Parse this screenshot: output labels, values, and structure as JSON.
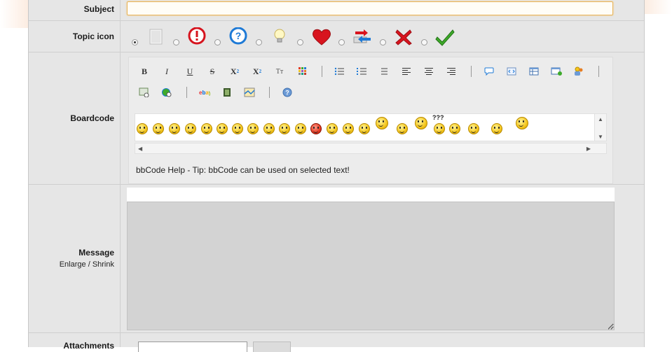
{
  "subject": {
    "label": "Subject",
    "value": ""
  },
  "topic_icon": {
    "label": "Topic icon",
    "selected_index": 0,
    "icons": [
      "blank-page-icon",
      "exclamation-icon",
      "question-icon",
      "lightbulb-icon",
      "heart-icon",
      "redirect-arrows-icon",
      "red-x-icon",
      "green-check-icon"
    ]
  },
  "boardcode": {
    "label": "Boardcode",
    "buttons": {
      "bold": "B",
      "italic": "I",
      "underline": "U",
      "strike": "S",
      "subscript": "X",
      "subscript_mark": "2",
      "superscript": "X",
      "superscript_mark": "2",
      "typeface": "Tт"
    },
    "help_text": "bbCode Help - Tip: bbCode can be used on selected text!",
    "smiley_question_marks": "???"
  },
  "message": {
    "label": "Message",
    "enlarge": "Enlarge",
    "separator": "/",
    "shrink": "Shrink",
    "value": ""
  },
  "attachments": {
    "label": "Attachments"
  },
  "colors": {
    "accent_border": "#e8b45a",
    "row_bg": "#e6e6e6",
    "textarea_bg": "#d3d3d3"
  }
}
